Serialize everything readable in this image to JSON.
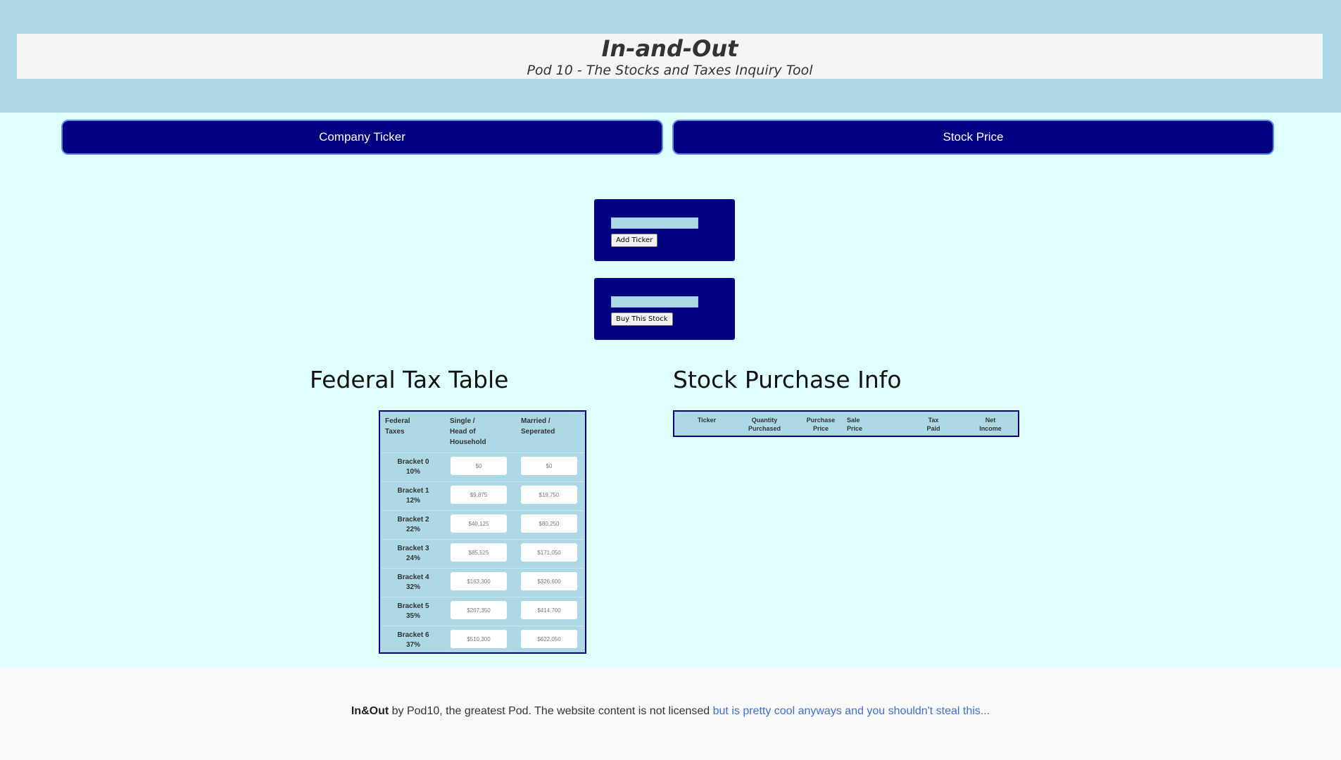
{
  "header": {
    "title": "In-and-Out",
    "subtitle": "Pod 10 - The Stocks and Taxes Inquiry Tool"
  },
  "nav": {
    "company_ticker": "Company Ticker",
    "stock_price": "Stock Price"
  },
  "ticker_panel": {
    "input_value": "",
    "button_label": "Add Ticker"
  },
  "buy_panel": {
    "input_value": "",
    "button_label": "Buy This Stock"
  },
  "tax_section": {
    "title": "Federal Tax Table",
    "headers": [
      "Federal\nTaxes",
      "Single /\nHead of\nHousehold",
      "Married /\nSeperated"
    ],
    "rows": [
      {
        "bracket": "Bracket 0",
        "rate": "10%",
        "single": "$0",
        "married": "$0"
      },
      {
        "bracket": "Bracket 1",
        "rate": "12%",
        "single": "$9,875",
        "married": "$19,750"
      },
      {
        "bracket": "Bracket 2",
        "rate": "22%",
        "single": "$40,125",
        "married": "$80,250"
      },
      {
        "bracket": "Bracket 3",
        "rate": "24%",
        "single": "$85,525",
        "married": "$171,050"
      },
      {
        "bracket": "Bracket 4",
        "rate": "32%",
        "single": "$163,300",
        "married": "$326,600"
      },
      {
        "bracket": "Bracket 5",
        "rate": "35%",
        "single": "$207,350",
        "married": "$414,700"
      },
      {
        "bracket": "Bracket 6",
        "rate": "37%",
        "single": "$510,300",
        "married": "$622,050"
      }
    ]
  },
  "stock_section": {
    "title": "Stock Purchase Info",
    "headers": [
      "Ticker",
      "Quantity\nPurchased",
      "Purchase\nPrice",
      "Sale\nPrice",
      "Tax\nPaid",
      "Net\nIncome"
    ]
  },
  "footer": {
    "brand": "In&Out",
    "text": " by Pod10, the greatest Pod. The website content is not licensed ",
    "link": "but is pretty cool anyways and you shouldn't steal this..."
  }
}
